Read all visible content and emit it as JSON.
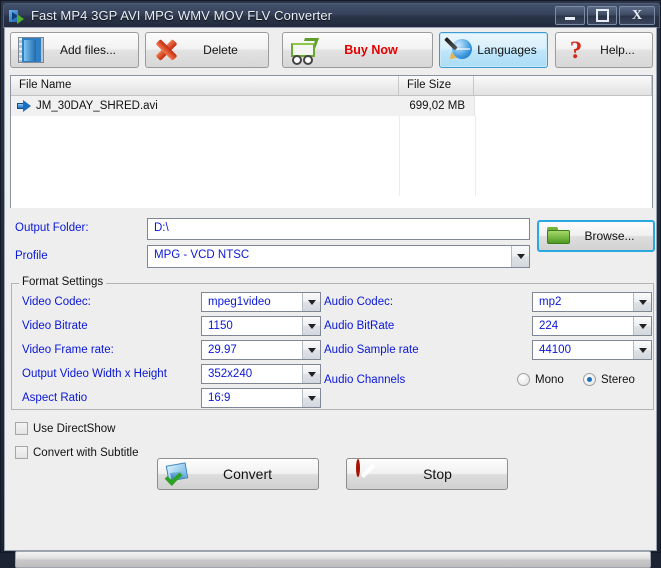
{
  "window": {
    "title": "Fast MP4 3GP AVI MPG WMV MOV FLV Converter",
    "icon": "converter-app-icon",
    "minimize_label": "Minimize",
    "maximize_label": "Maximize",
    "close_label": "X"
  },
  "toolbar": {
    "buttons": [
      {
        "label": "Add files...",
        "icon": "film-strip-icon"
      },
      {
        "label": "Delete",
        "icon": "red-x-icon"
      },
      {
        "label": "Buy Now",
        "icon": "shopping-cart-icon"
      },
      {
        "label": "Languages",
        "icon": "globe-pen-icon"
      },
      {
        "label": "Help...",
        "icon": "question-mark-icon"
      }
    ]
  },
  "file_list": {
    "columns": [
      "File Name",
      "File Size",
      ""
    ],
    "rows": [
      {
        "name": "JM_30DAY_SHRED.avi",
        "size": "699,02 MB",
        "icon": "blue-arrow-icon"
      }
    ]
  },
  "output": {
    "folder_label": "Output Folder:",
    "folder_value": "D:\\",
    "folder_placeholder": "D:\\",
    "profile_label": "Profile",
    "profile_value": "MPG - VCD NTSC",
    "browse_label": "Browse...",
    "browse_icon": "green-folder-icon"
  },
  "format_settings": {
    "title": "Format Settings",
    "video": [
      {
        "label": "Video Codec:",
        "value": "mpeg1video"
      },
      {
        "label": "Video Bitrate",
        "value": "1150"
      },
      {
        "label": "Video Frame rate:",
        "value": "29.97"
      },
      {
        "label": "Output Video Width x Height",
        "value": "352x240"
      },
      {
        "label": "Aspect Ratio",
        "value": "16:9"
      }
    ],
    "audio": [
      {
        "label": "Audio Codec:",
        "value": "mp2"
      },
      {
        "label": "Audio BitRate",
        "value": "224"
      },
      {
        "label": "Audio Sample rate",
        "value": "44100"
      }
    ],
    "channels_label": "Audio Channels",
    "channels": [
      {
        "label": "Mono",
        "selected": false
      },
      {
        "label": "Stereo",
        "selected": true
      }
    ]
  },
  "options": [
    {
      "label": "Use DirectShow",
      "checked": false
    },
    {
      "label": "Convert with Subtitle",
      "checked": false
    }
  ],
  "actions": {
    "convert_label": "Convert",
    "convert_icon": "convert-picture-check-icon",
    "stop_label": "Stop",
    "stop_icon": "stop-no-entry-icon"
  },
  "progress": {
    "value": 0,
    "label": ""
  },
  "colors": {
    "label_blue": "#0a17d6",
    "buy_now_red": "#e40000",
    "focus_cyan": "#2aa9e0",
    "titlebar_dark": "#2b3448"
  }
}
